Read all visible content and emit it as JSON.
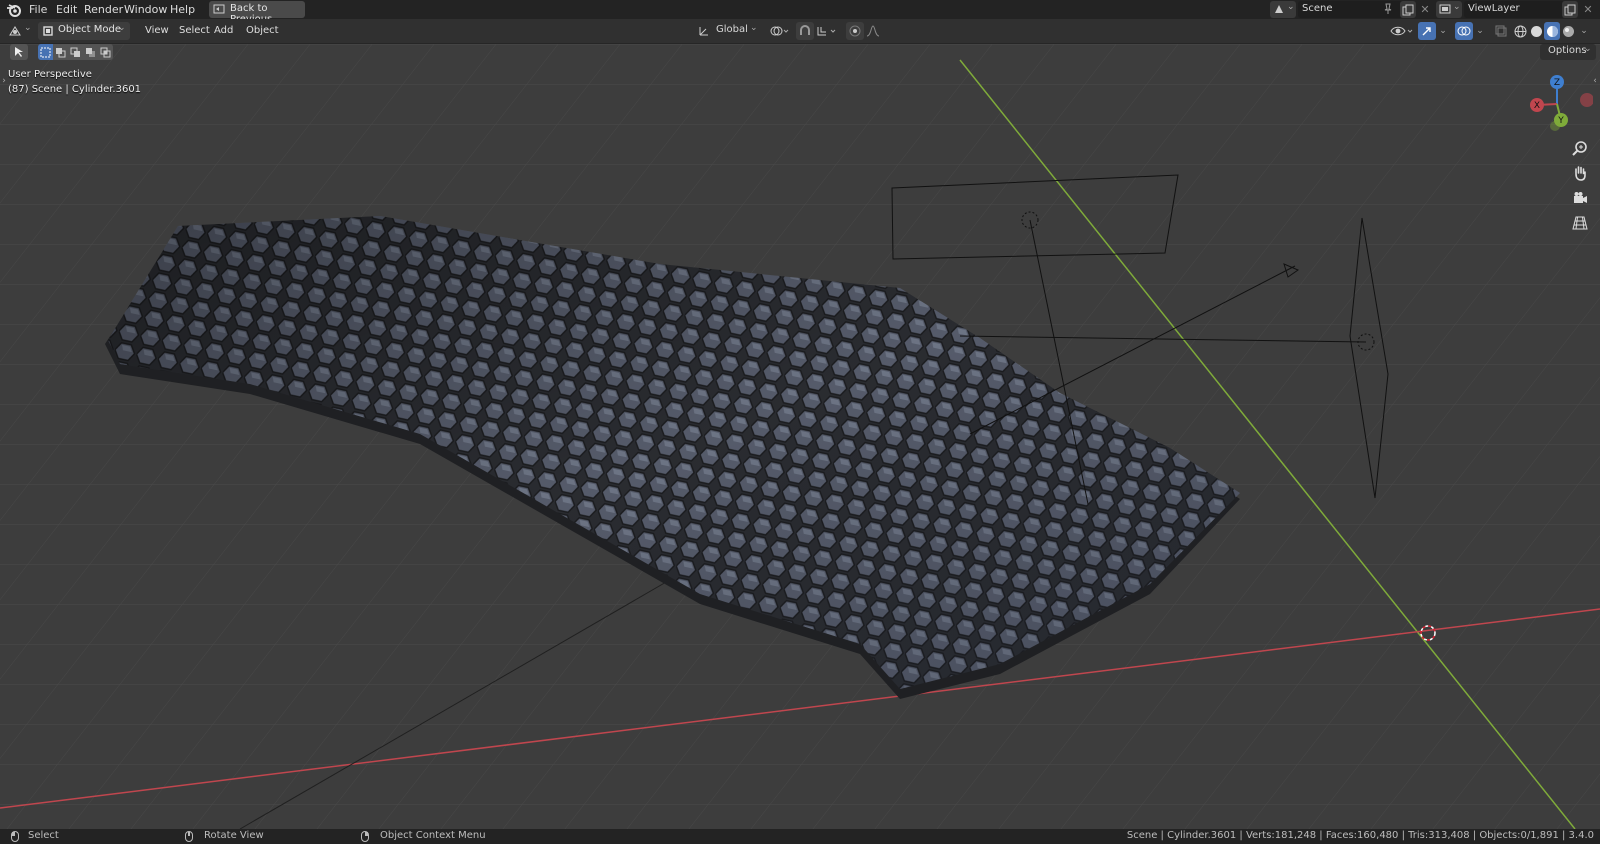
{
  "top_menu": {
    "items": [
      "File",
      "Edit",
      "Render",
      "Window",
      "Help"
    ],
    "back_button": "Back to Previous"
  },
  "scene": {
    "label": "Scene"
  },
  "view_layer": {
    "label": "ViewLayer"
  },
  "header": {
    "mode": "Object Mode",
    "menus": [
      "View",
      "Select",
      "Add",
      "Object"
    ],
    "orientation": "Global",
    "options": "Options"
  },
  "viewport": {
    "perspective": "User Perspective",
    "object_info": "(87) Scene | Cylinder.3601"
  },
  "gizmo": {
    "x": "X",
    "y": "Y",
    "z": "Z"
  },
  "status_bar": {
    "select": "Select",
    "rotate_view": "Rotate View",
    "context_menu": "Object Context Menu",
    "stats": "Scene | Cylinder.3601 | Verts:181,248 | Faces:160,480 | Tris:313,408 | Objects:0/1,891 | 3.4.0"
  },
  "colors": {
    "x_axis": "#c0464e",
    "y_axis": "#7fab3a",
    "z_axis": "#3f7fd0",
    "accent": "#4772b3",
    "topbar": "#232323",
    "header": "#303030",
    "viewport": "#3c3c3c"
  },
  "icons": [
    "blender-logo-icon",
    "back-to-previous-icon",
    "scene-icon",
    "pin-icon",
    "copy-icon",
    "close-icon",
    "view-layer-icon",
    "editor-type-icon",
    "object-mode-icon",
    "transform-orientation-icon",
    "pivot-icon",
    "snap-icon",
    "proportional-editing-icon",
    "falloff-icon",
    "visibility-icon",
    "gizmo-icon",
    "overlay-icon",
    "xray-icon",
    "wireframe-shading-icon",
    "solid-shading-icon",
    "material-shading-icon",
    "rendered-shading-icon",
    "zoom-icon",
    "pan-hand-icon",
    "camera-icon",
    "perspective-grid-icon",
    "select-tool-icon",
    "mouse-left-icon",
    "mouse-middle-icon",
    "mouse-right-icon"
  ]
}
